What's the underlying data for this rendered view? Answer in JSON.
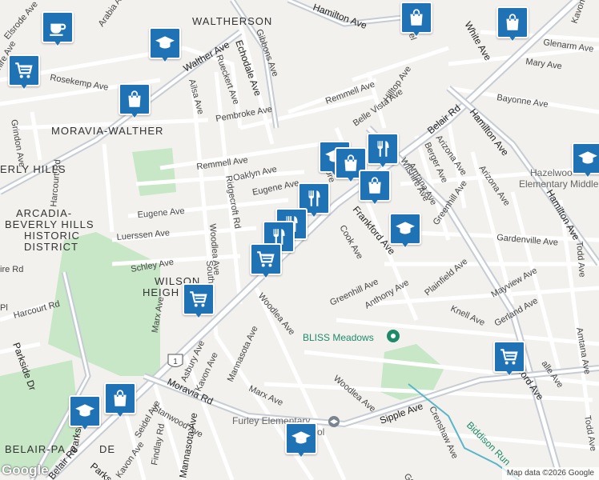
{
  "neighborhoods": [
    "WALTHERSON",
    "MORAVIA-WALTHER",
    "ERLY HILLS",
    "ARCADIA-",
    "BEVERLY HILLS",
    "HISTORIC",
    "DISTRICT",
    "WILSON",
    "HEIGH",
    "BELAIR-PA",
    "DE"
  ],
  "streets": {
    "hamilton_ave_top": "Hamilton Ave",
    "hamilton_ave_right": "Hamilton Ave",
    "hamilton_ave_right2": "Hamilton Ave",
    "white_ave": "White Ave",
    "glenarm_ave": "Glenarm Ave",
    "mary_ave": "Mary Ave",
    "bayonne_ave": "Bayonne Ave",
    "kavon_top": "Kavon",
    "belair_rd_top": "Belair Rd",
    "belair_rd_bottom": "Belair Rd",
    "frankford_ave": "Frankford Ave",
    "frankford_ave2": "Frankford Ave",
    "walther_ave": "Walther Ave",
    "echodale_ave": "Echodale Ave",
    "gibbons_ave": "Gibbons Ave",
    "rueckert_ave": "Rueckert Ave",
    "arabia_ave": "Arabia Ave",
    "elsrode_ave": "Elsrode Ave",
    "rosekemp_ave": "Rosekemp Ave",
    "grindon_ave": "Grindon Ave",
    "ailsa_ave": "Ailsa Ave",
    "pembroke_ave": "Pembroke Ave",
    "remmell_ave": "Remmell Ave",
    "remmell_ave2": "Remmell Ave",
    "belle_vista_ave": "Belle Vista Ave",
    "hilltop_ave": "Hilltop Ave",
    "oaklyn_ave": "Oaklyn Ave",
    "eugene_ave": "Eugene Ave",
    "eugene_ave2": "Eugene Ave",
    "harcourt_rd": "Harcourt Rd",
    "harcourt_rd2": "Harcourt Rd",
    "ridgecroft_rd": "Ridgecroft Rd",
    "woodlea_ave": "Woodlea Ave",
    "woodlea_ave2": "Woodlea Ave",
    "woodlea_ave3": "Woodlea Ave",
    "luerssen_ave": "Luerssen Ave",
    "schley_ave": "Schley Ave",
    "southern_ave": "Southe",
    "marx_ave": "Marx Ave",
    "marx_ave2": "Marx Ave",
    "asbury_ave": "Asbury Ave",
    "kavon_ave": "Kavon Ave",
    "kavon_ave2": "Kavon Ave",
    "mannasota_ave": "Mannasota Ave",
    "mannasota_ave2": "Mannasota Ave",
    "moravia_rd": "Moravia Rd",
    "stanwood_ave": "Stanwood Ave",
    "seidel_ave": "Seidel Ave",
    "findlay_rd": "Findlay Rd",
    "parkside_dr": "Parkside Dr",
    "parkside_dr2": "Parkside Dr",
    "parks": "Parks",
    "amtana_ave": "Amtana Ave",
    "amtana_ave2": "Amtana Ave",
    "arizona_ave": "Arizona Ave",
    "arizona_ave2": "Arizona Ave",
    "berger_ave": "Berger Ave",
    "wilshire_ave": "Wilshire Ave",
    "greenhill_ave": "Greenhill Ave",
    "greenhill_ave2": "Greenhill Ave",
    "cook_ave": "Cook Ave",
    "anthony_ave": "Anthony Ave",
    "gardenville_ave": "Gardenville Ave",
    "plainfield_ave": "Plainfield Ave",
    "knell_ave": "Knell Ave",
    "mayview_ave": "Mayview Ave",
    "gerland_ave": "Gerland Ave",
    "todd_ave": "Todd Ave",
    "todd_ave2": "Todd Ave",
    "sipple_ave": "Sipple Ave",
    "crenshaw_ave": "Crenshaw Ave",
    "biddison_run": "Biddison Run",
    "lasalle_ave": "alle Ave",
    "elmore": "Elmore",
    "bel": "Bel",
    "goo": "Goo",
    "ire_rd": "ire Rd",
    "pl": "Pl",
    "hire_ave": "hire Ave",
    "route_1": "1"
  },
  "pois": {
    "hazelwood": "Hazelwoo",
    "hazelwood_sub": "Elementary Middle",
    "bliss_meadows": "BLISS Meadows",
    "furley": "Furley Elementary",
    "furley_sub": "ol"
  },
  "markers": [
    {
      "type": "cafe",
      "icon": "cup-icon"
    },
    {
      "type": "school",
      "icon": "mortarboard-icon"
    },
    {
      "type": "grocery",
      "icon": "cart-icon"
    },
    {
      "type": "store",
      "icon": "bag-icon"
    },
    {
      "type": "store",
      "icon": "bag-icon"
    },
    {
      "type": "store",
      "icon": "bag-icon"
    },
    {
      "type": "school",
      "icon": "mortarboard-icon"
    },
    {
      "type": "restaurant",
      "icon": "fork-knife-icon"
    },
    {
      "type": "store",
      "icon": "bag-icon"
    },
    {
      "type": "store",
      "icon": "bag-icon"
    },
    {
      "type": "restaurant",
      "icon": "fork-knife-icon"
    },
    {
      "type": "restaurant",
      "icon": "fork-knife-icon"
    },
    {
      "type": "restaurant",
      "icon": "fork-knife-icon"
    },
    {
      "type": "grocery",
      "icon": "cart-icon"
    },
    {
      "type": "school",
      "icon": "mortarboard-icon"
    },
    {
      "type": "grocery",
      "icon": "cart-icon"
    },
    {
      "type": "store",
      "icon": "bag-icon"
    },
    {
      "type": "school",
      "icon": "mortarboard-icon"
    },
    {
      "type": "school",
      "icon": "mortarboard-icon"
    },
    {
      "type": "grocery",
      "icon": "cart-icon"
    },
    {
      "type": "school",
      "icon": "mortarboard-icon"
    }
  ],
  "google_logo": "Google",
  "attribution": "Map data ©2026 Google",
  "colors": {
    "background": "#f2f1ee",
    "road": "#ffffff",
    "arterial": "#c6ccd4",
    "park": "#c7e7c7",
    "water": "#59b6c8",
    "marker": "#1f73b5"
  }
}
